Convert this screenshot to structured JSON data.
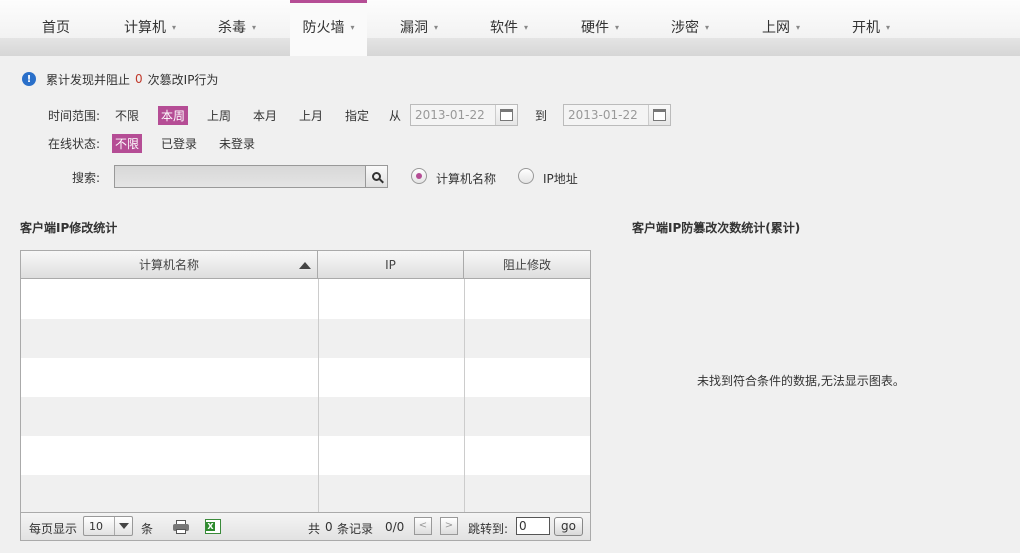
{
  "nav": {
    "items": [
      {
        "label": "首页",
        "dropdown": false
      },
      {
        "label": "计算机",
        "dropdown": true
      },
      {
        "label": "杀毒",
        "dropdown": true
      },
      {
        "label": "防火墙",
        "dropdown": true,
        "active": true
      },
      {
        "label": "漏洞",
        "dropdown": true
      },
      {
        "label": "软件",
        "dropdown": true
      },
      {
        "label": "硬件",
        "dropdown": true
      },
      {
        "label": "涉密",
        "dropdown": true
      },
      {
        "label": "上网",
        "dropdown": true
      },
      {
        "label": "开机",
        "dropdown": true
      }
    ],
    "caret": "▾"
  },
  "info": {
    "prefix": "累计发现并阻止",
    "count": "0",
    "suffix": "次篡改IP行为",
    "icon": "info-icon"
  },
  "filters": {
    "time_label": "时间范围:",
    "time_options": [
      "不限",
      "本周",
      "上周",
      "本月",
      "上月",
      "指定"
    ],
    "time_selected": "本周",
    "from_label": "从",
    "from_date": "2013-01-22",
    "to_label": "到",
    "to_date": "2013-01-22",
    "status_label": "在线状态:",
    "status_options": [
      "不限",
      "已登录",
      "未登录"
    ],
    "status_selected": "不限",
    "search_label": "搜索:",
    "search_value": "",
    "radio_options": [
      "计算机名称",
      "IP地址"
    ],
    "radio_selected": "计算机名称"
  },
  "left_section": {
    "title": "客户端IP修改统计",
    "columns": [
      "计算机名称",
      "IP",
      "阻止修改"
    ],
    "rows": []
  },
  "footer": {
    "per_page_label": "每页显示",
    "per_page_value": "10",
    "per_page_unit": "条",
    "total_prefix": "共",
    "total_count": "0",
    "total_suffix": "条记录",
    "page_info": "0/0",
    "prev": "<",
    "next": ">",
    "jump_label": "跳转到:",
    "jump_value": "0",
    "go_label": "go"
  },
  "right_section": {
    "title": "客户端IP防篡改次数统计(累计)",
    "no_data": "未找到符合条件的数据,无法显示图表。"
  },
  "colors": {
    "accent": "#b54d95",
    "info_blue": "#2a6fc9",
    "count_red": "#c0392b"
  }
}
